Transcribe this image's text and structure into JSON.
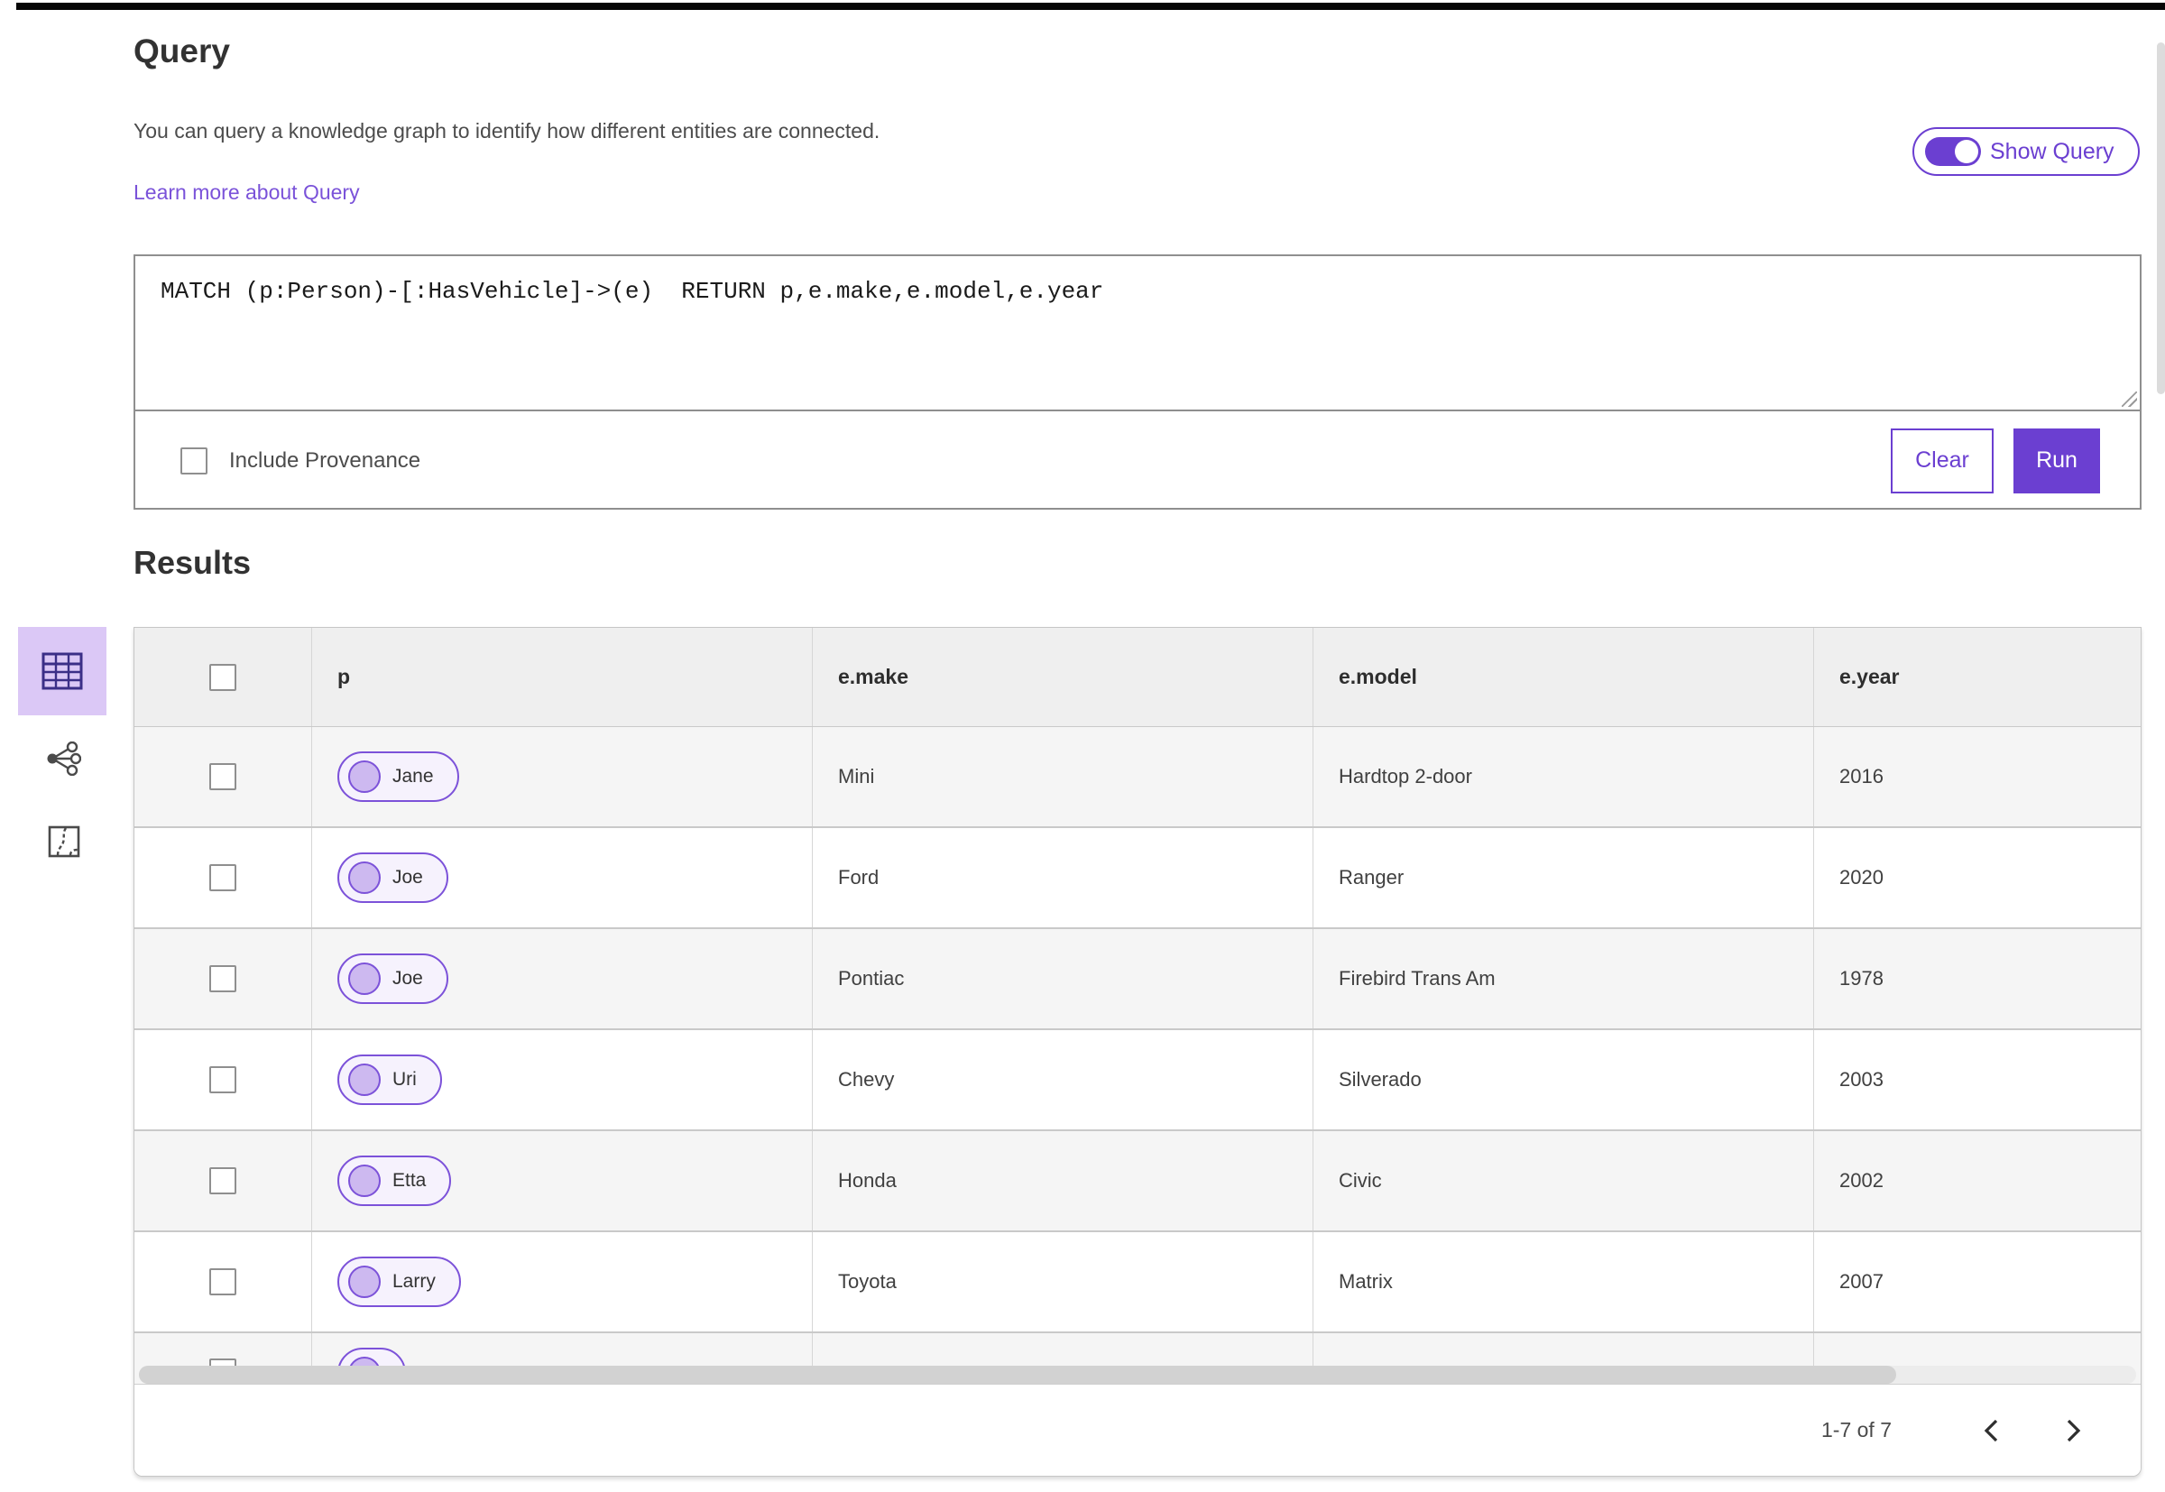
{
  "header": {
    "title": "Query",
    "description": "You can query a knowledge graph to identify how different entities are connected.",
    "learn_more_link": "Learn more about Query",
    "show_query_toggle": {
      "label": "Show Query",
      "state": "on"
    }
  },
  "query_editor": {
    "text": "MATCH (p:Person)-[:HasVehicle]->(e)  RETURN p,e.make,e.model,e.year",
    "include_provenance": {
      "label": "Include Provenance",
      "checked": false
    },
    "clear_button": "Clear",
    "run_button": "Run"
  },
  "results": {
    "heading": "Results",
    "view_modes": [
      {
        "icon": "table-view-icon",
        "selected": true
      },
      {
        "icon": "link-chart-view-icon",
        "selected": false
      },
      {
        "icon": "map-view-icon",
        "selected": false
      }
    ],
    "table": {
      "columns": [
        "p",
        "e.make",
        "e.model",
        "e.year"
      ],
      "rows": [
        {
          "p": "Jane",
          "make": "Mini",
          "model": "Hardtop 2-door",
          "year": "2016"
        },
        {
          "p": "Joe",
          "make": "Ford",
          "model": "Ranger",
          "year": "2020"
        },
        {
          "p": "Joe",
          "make": "Pontiac",
          "model": "Firebird Trans Am",
          "year": "1978"
        },
        {
          "p": "Uri",
          "make": "Chevy",
          "model": "Silverado",
          "year": "2003"
        },
        {
          "p": "Etta",
          "make": "Honda",
          "model": "Civic",
          "year": "2002"
        },
        {
          "p": "Larry",
          "make": "Toyota",
          "model": "Matrix",
          "year": "2007"
        }
      ],
      "partial_row_visible": true
    },
    "pagination": {
      "range_label": "1-7 of 7"
    }
  },
  "colors": {
    "accent_purple": "#6b3fd1",
    "pill_border": "#7c52d9",
    "pill_fill": "#f6f2fd",
    "pill_dot": "#cdb9f0",
    "selected_tile": "#dbc8f6",
    "icon_indigo": "#3b2f87",
    "link": "#7a52d9",
    "header_row_bg": "#efefef",
    "stripe_row_bg": "#f5f5f5"
  }
}
